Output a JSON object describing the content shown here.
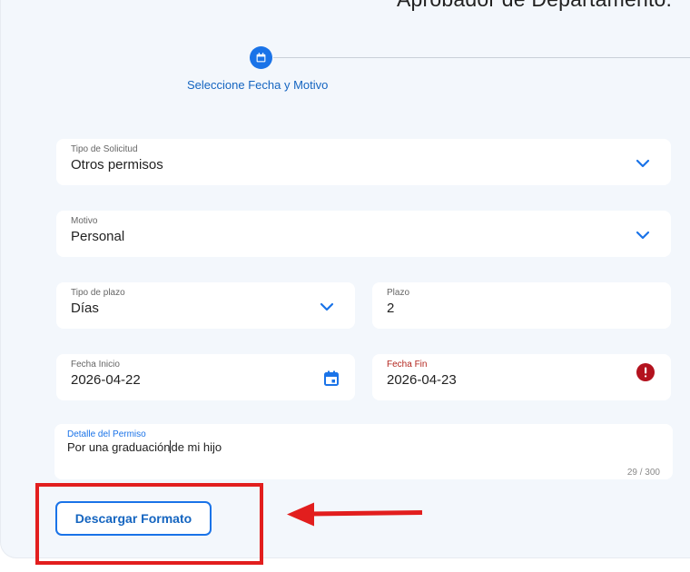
{
  "header": {
    "title": "Aprobador de Departamento."
  },
  "stepper": {
    "step_label": "Seleccione Fecha y Motivo"
  },
  "form": {
    "tipo_solicitud": {
      "label": "Tipo de Solicitud",
      "value": "Otros permisos"
    },
    "motivo": {
      "label": "Motivo",
      "value": "Personal"
    },
    "tipo_plazo": {
      "label": "Tipo de plazo",
      "value": "Días"
    },
    "plazo": {
      "label": "Plazo",
      "value": "2"
    },
    "fecha_inicio": {
      "label": "Fecha Inicio",
      "value": "2026-04-22"
    },
    "fecha_fin": {
      "label": "Fecha Fin",
      "value": "2026-04-23"
    },
    "detalle": {
      "label": "Detalle del Permiso",
      "value_before_caret": "Por una graduación",
      "value_after_caret": "de mi hijo",
      "counter": "29 / 300"
    }
  },
  "actions": {
    "download_label": "Descargar Formato"
  },
  "colors": {
    "accent": "#1a73e8",
    "error": "#b3261e",
    "annotation": "#e21e1e",
    "panel_bg": "#f3f7fc"
  },
  "icons": {
    "step": "calendar-icon",
    "dropdown": "chevron-down-icon",
    "date_picker": "calendar-icon",
    "error": "error-icon",
    "annotation": "arrow-left-icon"
  }
}
